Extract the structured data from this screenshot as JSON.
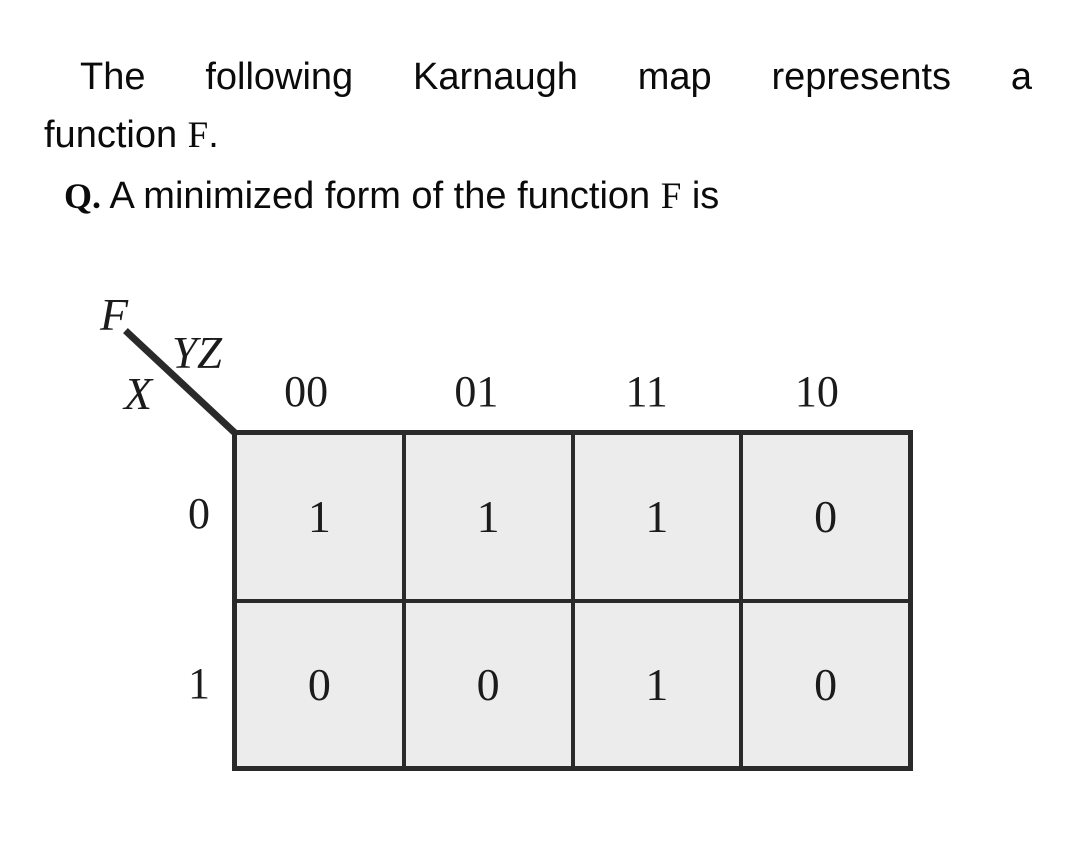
{
  "question": {
    "intro_line_words": [
      "The",
      "following",
      "Karnaugh",
      "map",
      "represents",
      "a"
    ],
    "intro_line_2_prefix": "function ",
    "intro_line_2_symbol": "F",
    "intro_line_2_suffix": ".",
    "q_marker": "Q.",
    "q_text_before_symbol": " A minimized form of the function ",
    "q_symbol": "F",
    "q_text_after_symbol": " is"
  },
  "kmap": {
    "function_label": "F",
    "column_var_label": "YZ",
    "row_var_label": "X",
    "column_headers": [
      "00",
      "01",
      "11",
      "10"
    ],
    "row_headers": [
      "0",
      "1"
    ],
    "rows": [
      {
        "header": "0",
        "values": [
          "1",
          "1",
          "1",
          "0"
        ]
      },
      {
        "header": "1",
        "values": [
          "0",
          "0",
          "1",
          "0"
        ]
      }
    ],
    "colors": {
      "cell_fill": "#ECECEC",
      "border": "#2A2A2A",
      "text": "#1B1B1B",
      "page_background": "#FFFFFF"
    }
  }
}
